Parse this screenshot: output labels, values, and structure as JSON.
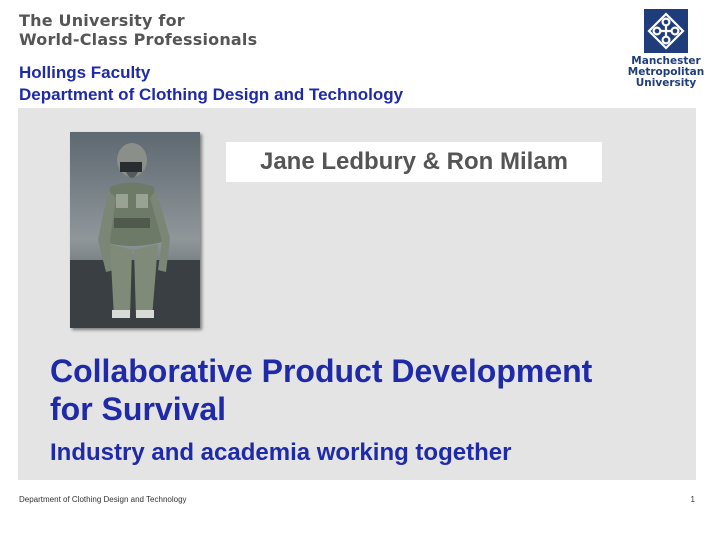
{
  "header": {
    "tagline_line1": "The University for",
    "tagline_line2": "World-Class Professionals"
  },
  "logo": {
    "icon": "mmu-crest-icon",
    "name_line1": "Manchester",
    "name_line2": "Metropolitan",
    "name_line3": "University",
    "color": "#1f3d7a"
  },
  "faculty": {
    "line1": "Hollings Faculty",
    "line2": "Department of Clothing Design and Technology"
  },
  "slide": {
    "authors": "Jane Ledbury & Ron Milam",
    "title_line1": "Collaborative Product Development",
    "title_line2": "for Survival",
    "subtitle": "Industry and academia working together"
  },
  "footer": {
    "department": "Department of Clothing Design and Technology",
    "page_number": "1"
  },
  "colors": {
    "title_blue": "#1f2aa8",
    "panel_gray": "#e4e4e4"
  }
}
